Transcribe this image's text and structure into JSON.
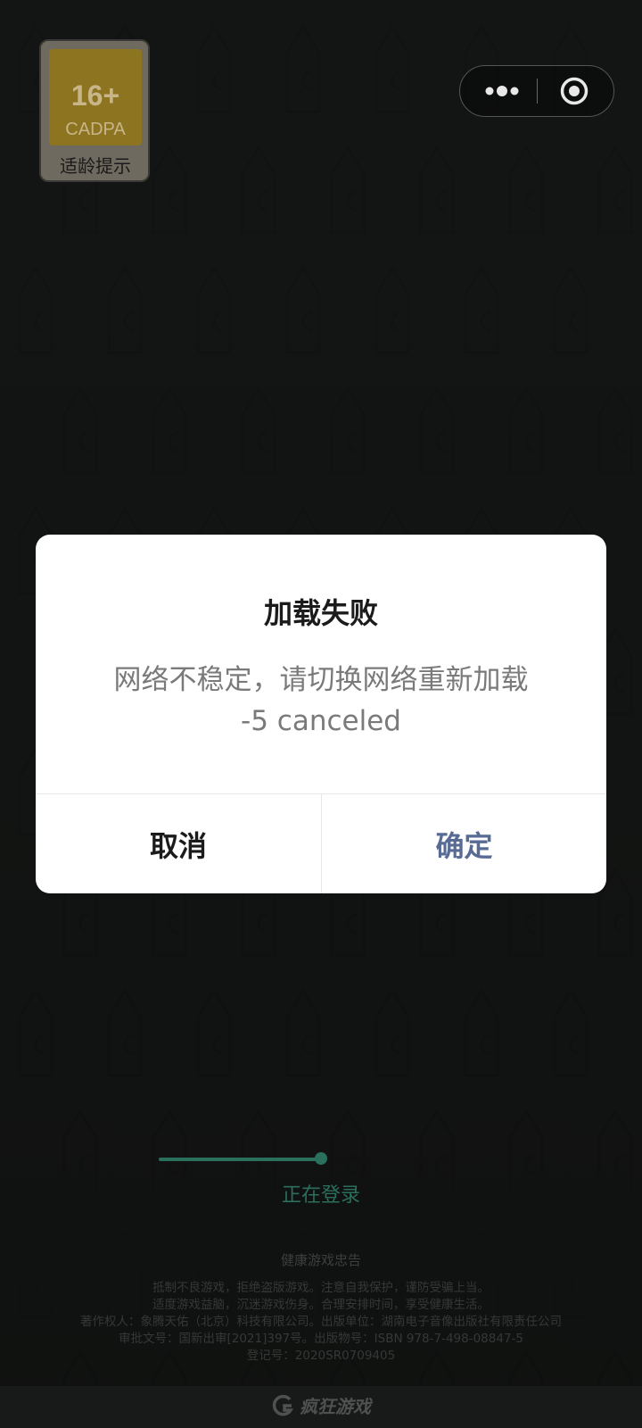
{
  "age_badge": {
    "age": "16+",
    "org": "CADPA",
    "hint": "适龄提示"
  },
  "capsule": {
    "more_icon": "more-dots-icon",
    "close_icon": "target-close-icon"
  },
  "dialog": {
    "title": "加载失败",
    "message_line1": "网络不稳定，请切换网络重新加载",
    "message_line2": "-5 canceled",
    "cancel_label": "取消",
    "confirm_label": "确定",
    "confirm_color": "#576b95"
  },
  "loading": {
    "progress": 0.5,
    "status": "正在登录",
    "accent_color": "#2b6f5d"
  },
  "health_notice": {
    "title": "健康游戏忠告",
    "lines": [
      "抵制不良游戏，拒绝盗版游戏。注意自我保护，谨防受骗上当。",
      "适度游戏益脑，沉迷游戏伤身。合理安排时间，享受健康生活。",
      "著作权人：象腾天佑（北京）科技有限公司。出版单位：湖南电子音像出版社有限责任公司",
      "审批文号：国新出审[2021]397号。出版物号：ISBN 978-7-498-08847-5",
      "登记号：2020SR0709405"
    ]
  },
  "footer": {
    "brand": "疯狂游戏",
    "logo_icon": "brand-logo-icon"
  }
}
